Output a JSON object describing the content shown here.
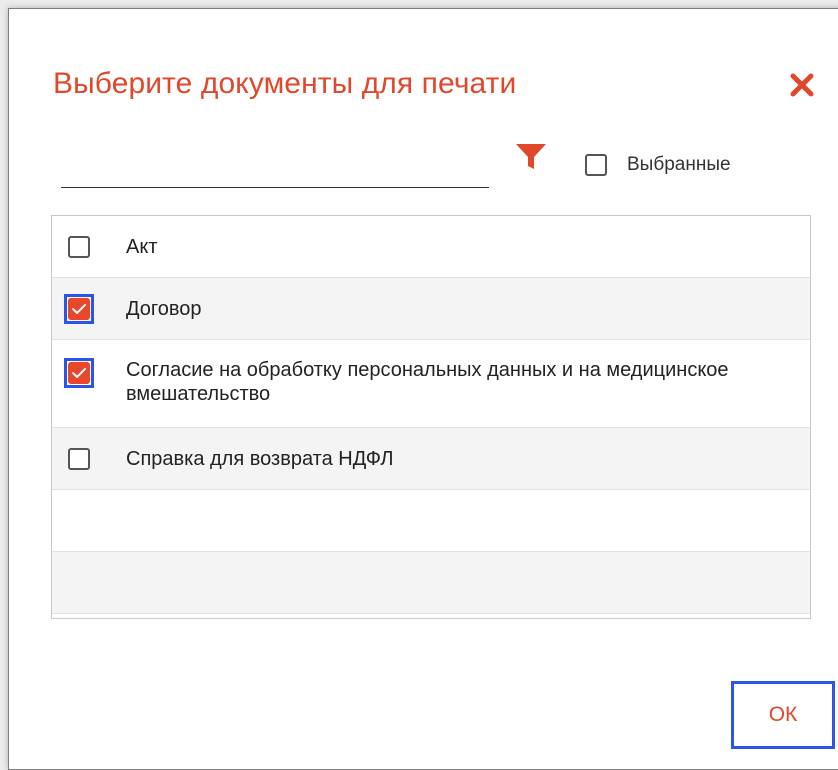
{
  "dialog": {
    "title": "Выберите документы для печати",
    "search_placeholder": "",
    "selected_only_label": "Выбранные",
    "ok_label": "ОК"
  },
  "documents": [
    {
      "label": "Акт",
      "checked": false,
      "focused": false
    },
    {
      "label": "Договор",
      "checked": true,
      "focused": true
    },
    {
      "label": "Согласие на обработку персональных данных и на медицинское вмешательство",
      "checked": true,
      "focused": true
    },
    {
      "label": "Справка для возврата НДФЛ",
      "checked": false,
      "focused": false
    },
    {
      "label": "",
      "checked": null,
      "focused": false
    },
    {
      "label": "",
      "checked": null,
      "focused": false
    }
  ],
  "colors": {
    "accent": "#e0472b",
    "focus": "#2b55e6"
  },
  "icons": {
    "close": "close-icon",
    "filter": "filter-icon",
    "check": "checkmark-icon"
  }
}
